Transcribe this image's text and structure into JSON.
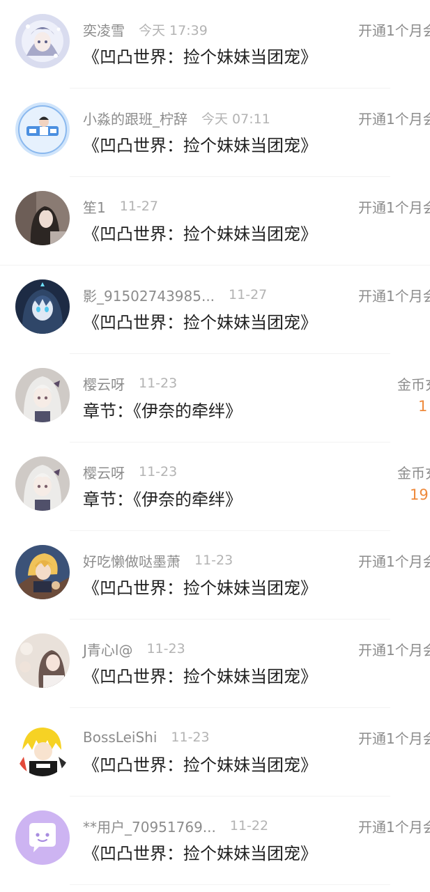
{
  "records": [
    {
      "name": "奕凌雪",
      "time": "今天 17:39",
      "title": "《凹凸世界：捡个妹妹当团宠》",
      "right_label": "开通1个月会",
      "avatar": "avatar-snow-girl"
    },
    {
      "name": "小淼的跟班_柠辞",
      "time": "今天 07:11",
      "title": "《凹凸世界：捡个妹妹当团宠》",
      "right_label": "开通1个月会",
      "avatar": "avatar-boy-badge"
    },
    {
      "name": "笙1",
      "time": "11-27",
      "title": "《凹凸世界：捡个妹妹当团宠》",
      "right_label": "开通1个月会",
      "avatar": "avatar-dark-hair-girl"
    },
    {
      "name": "影_91502743985...",
      "time": "11-27",
      "title": "《凹凸世界：捡个妹妹当团宠》",
      "right_label": "开通1个月会",
      "avatar": "avatar-anime-blue"
    },
    {
      "name": "樱云呀",
      "time": "11-23",
      "title": "章节：《伊奈的牵绊》",
      "right_label": "金币充",
      "amount": "1",
      "avatar": "avatar-silver-hair-girl"
    },
    {
      "name": "樱云呀",
      "time": "11-23",
      "title": "章节：《伊奈的牵绊》",
      "right_label": "金币充",
      "amount": "19",
      "avatar": "avatar-silver-hair-girl"
    },
    {
      "name": "好吃懒做哒墨萧",
      "time": "11-23",
      "title": "《凹凸世界：捡个妹妹当团宠》",
      "right_label": "开通1个月会",
      "avatar": "avatar-blonde-hero"
    },
    {
      "name": "J青心l@",
      "time": "11-23",
      "title": "《凹凸世界：捡个妹妹当团宠》",
      "right_label": "开通1个月会",
      "avatar": "avatar-flower-girl"
    },
    {
      "name": "BossLeiShi",
      "time": "11-23",
      "title": "《凹凸世界：捡个妹妹当团宠》",
      "right_label": "开通1个月会",
      "avatar": "avatar-yellow-character"
    },
    {
      "name": "**用户_70951769...",
      "time": "11-22",
      "title": "《凹凸世界：捡个妹妹当团宠》",
      "right_label": "开通1个月会",
      "avatar": "default-chat-bubble-icon"
    }
  ],
  "colors": {
    "name": "#8c8c8c",
    "time": "#b3b3b3",
    "title": "#1f1f1f",
    "amount": "#ee8a3c",
    "default_avatar": "#cdb4f2"
  }
}
